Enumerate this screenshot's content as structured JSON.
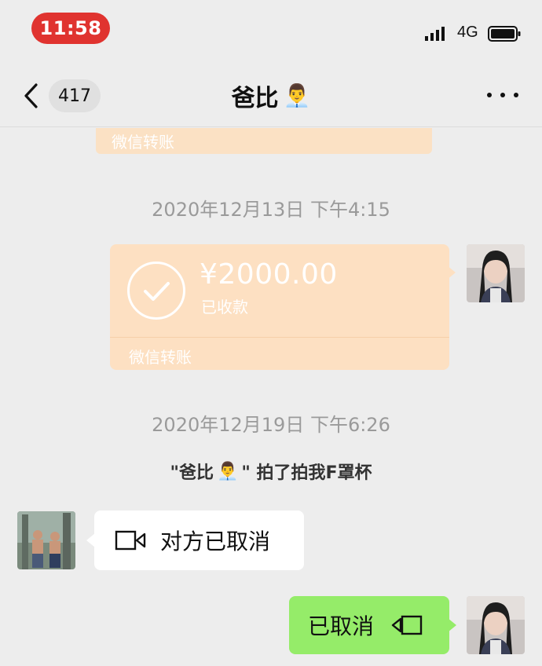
{
  "status_bar": {
    "time": "11:58",
    "network": "4G"
  },
  "nav": {
    "unread_count": "417",
    "title": "爸比",
    "title_emoji": "👨‍💼"
  },
  "messages": {
    "top_card_label": "微信转账",
    "timestamp_1": "2020年12月13日 下午4:15",
    "transfer": {
      "amount": "¥2000.00",
      "status": "已收款",
      "label": "微信转账"
    },
    "timestamp_2": "2020年12月19日 下午6:26",
    "pat": {
      "prefix": "\"爸比",
      "emoji": "👨‍💼",
      "suffix": "\" 拍了拍我F罩杯"
    },
    "call_incoming": "对方已取消",
    "call_outgoing": "已取消"
  },
  "colors": {
    "time_pill": "#e0332f",
    "transfer_card": "#fde0c2",
    "outgoing_bubble": "#95ec69",
    "background": "#ededed"
  }
}
